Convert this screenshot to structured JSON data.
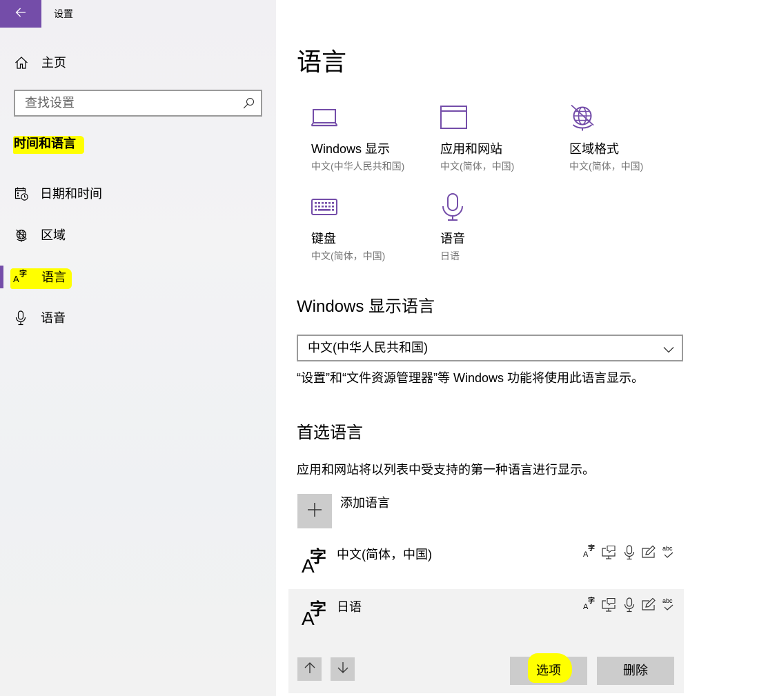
{
  "window": {
    "title": "设置",
    "back_icon": "back-arrow-icon"
  },
  "sidebar": {
    "home": {
      "label": "主页",
      "icon": "home-icon"
    },
    "search": {
      "placeholder": "查找设置",
      "value": "",
      "icon": "search-icon"
    },
    "section_title": "时间和语言",
    "items": [
      {
        "label": "日期和时间",
        "icon": "calendar-clock-icon",
        "selected": false
      },
      {
        "label": "区域",
        "icon": "globe-icon",
        "selected": false
      },
      {
        "label": "语言",
        "icon": "language-icon",
        "selected": true
      },
      {
        "label": "语音",
        "icon": "microphone-icon",
        "selected": false
      }
    ]
  },
  "glyphs": {
    "language_latin": "A",
    "language_cjk": "字",
    "spell_check": "abc"
  },
  "main": {
    "title": "语言",
    "tiles": [
      {
        "label": "Windows 显示",
        "value": "中文(中华人民共和国)",
        "icon": "laptop-icon"
      },
      {
        "label": "应用和网站",
        "value": "中文(简体，中国)",
        "icon": "app-window-icon"
      },
      {
        "label": "区域格式",
        "value": "中文(简体，中国)",
        "icon": "globe-icon"
      },
      {
        "label": "键盘",
        "value": "中文(简体，中国)",
        "icon": "keyboard-icon"
      },
      {
        "label": "语音",
        "value": "日语",
        "icon": "microphone-icon"
      }
    ],
    "display_language": {
      "heading": "Windows 显示语言",
      "selected": "中文(中华人民共和国)",
      "description": "“设置”和“文件资源管理器”等 Windows 功能将使用此语言显示。"
    },
    "preferred_languages": {
      "heading": "首选语言",
      "description": "应用和网站将以列表中受支持的第一种语言进行显示。",
      "add_label": "添加语言",
      "languages": [
        {
          "name": "中文(简体，中国)",
          "selected": false,
          "features": [
            "language-pack-icon",
            "text-to-speech-icon",
            "speech-recognition-icon",
            "handwriting-icon",
            "spell-check-icon"
          ]
        },
        {
          "name": "日语",
          "selected": true,
          "features": [
            "language-pack-icon",
            "text-to-speech-icon",
            "speech-recognition-icon",
            "handwriting-icon",
            "spell-check-icon"
          ]
        }
      ],
      "move_up_icon": "arrow-up-icon",
      "move_down_icon": "arrow-down-icon",
      "options_label": "选项",
      "remove_label": "删除"
    }
  },
  "colors": {
    "accent": "#744da9",
    "sidebar_bg": "#f2f2f2",
    "button_bg": "#cccccc",
    "selected_row_bg": "#f2f2f2",
    "secondary_text": "#767676",
    "annotation_highlight": "#ffff00"
  }
}
